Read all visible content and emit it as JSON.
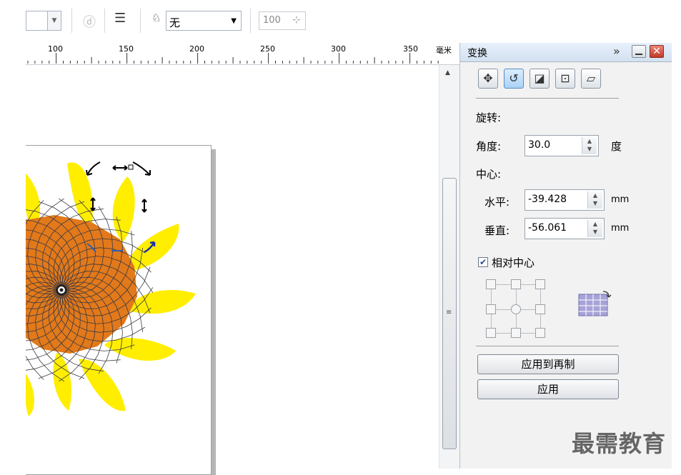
{
  "toolbar": {
    "outline_label": "无",
    "opacity_value": "100"
  },
  "ruler": {
    "ticks": [
      "100",
      "150",
      "200",
      "250",
      "300",
      "350"
    ],
    "unit": "毫米"
  },
  "panel": {
    "title": "变换",
    "expand_glyph": "»",
    "section_rotate": "旋转:",
    "angle_label": "角度:",
    "angle_value": "30.0",
    "angle_unit": "度",
    "center_label": "中心:",
    "horizontal_label": "水平:",
    "horizontal_value": "-39.428",
    "horizontal_unit": "mm",
    "vertical_label": "垂直:",
    "vertical_value": "-56.061",
    "vertical_unit": "mm",
    "relative_center_label": "相对中心",
    "relative_center_checked": true,
    "apply_to_duplicate_label": "应用到再制",
    "apply_label": "应用"
  },
  "watermark": "最需教育",
  "colors": {
    "petal": "#ffee00",
    "disk": "#e2791a",
    "disk_lines": "#3a3a44",
    "panel_bg": "#f2f2f2",
    "title_bar": "#d2e0f0"
  }
}
